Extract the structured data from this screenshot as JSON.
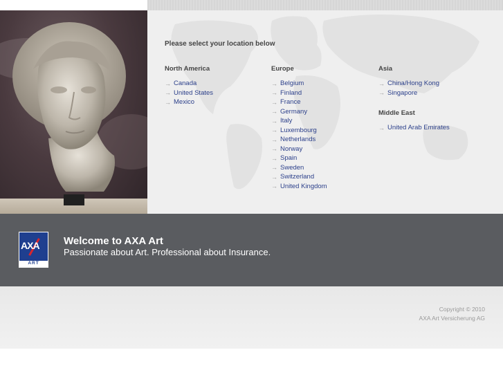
{
  "location_selector": {
    "heading": "Please select your location below",
    "regions": [
      {
        "title": "North America",
        "countries": [
          "Canada",
          "United States",
          "Mexico"
        ]
      },
      {
        "title": "Europe",
        "countries": [
          "Belgium",
          "Finland",
          "France",
          "Germany",
          "Italy",
          "Luxembourg",
          "Netherlands",
          "Norway",
          "Spain",
          "Sweden",
          "Switzerland",
          "United Kingdom"
        ]
      },
      {
        "title": "Asia",
        "countries": [
          "China/Hong Kong",
          "Singapore"
        ]
      },
      {
        "title": "Middle East",
        "countries": [
          "United Arab Emirates"
        ]
      }
    ],
    "link_arrow_icon": "arrow-right-icon"
  },
  "banner": {
    "logo_text": "AXA",
    "logo_subtext": "ART",
    "title": "Welcome to AXA Art",
    "tagline": "Passionate about Art. Professional about Insurance."
  },
  "footer": {
    "copyright": "Copyright © 2010",
    "company": "AXA Art Versicherung AG"
  },
  "colors": {
    "link": "#2b3f8a",
    "band": "#5a5c60",
    "logo_blue": "#1f3f8f",
    "logo_red": "#d8262e"
  }
}
